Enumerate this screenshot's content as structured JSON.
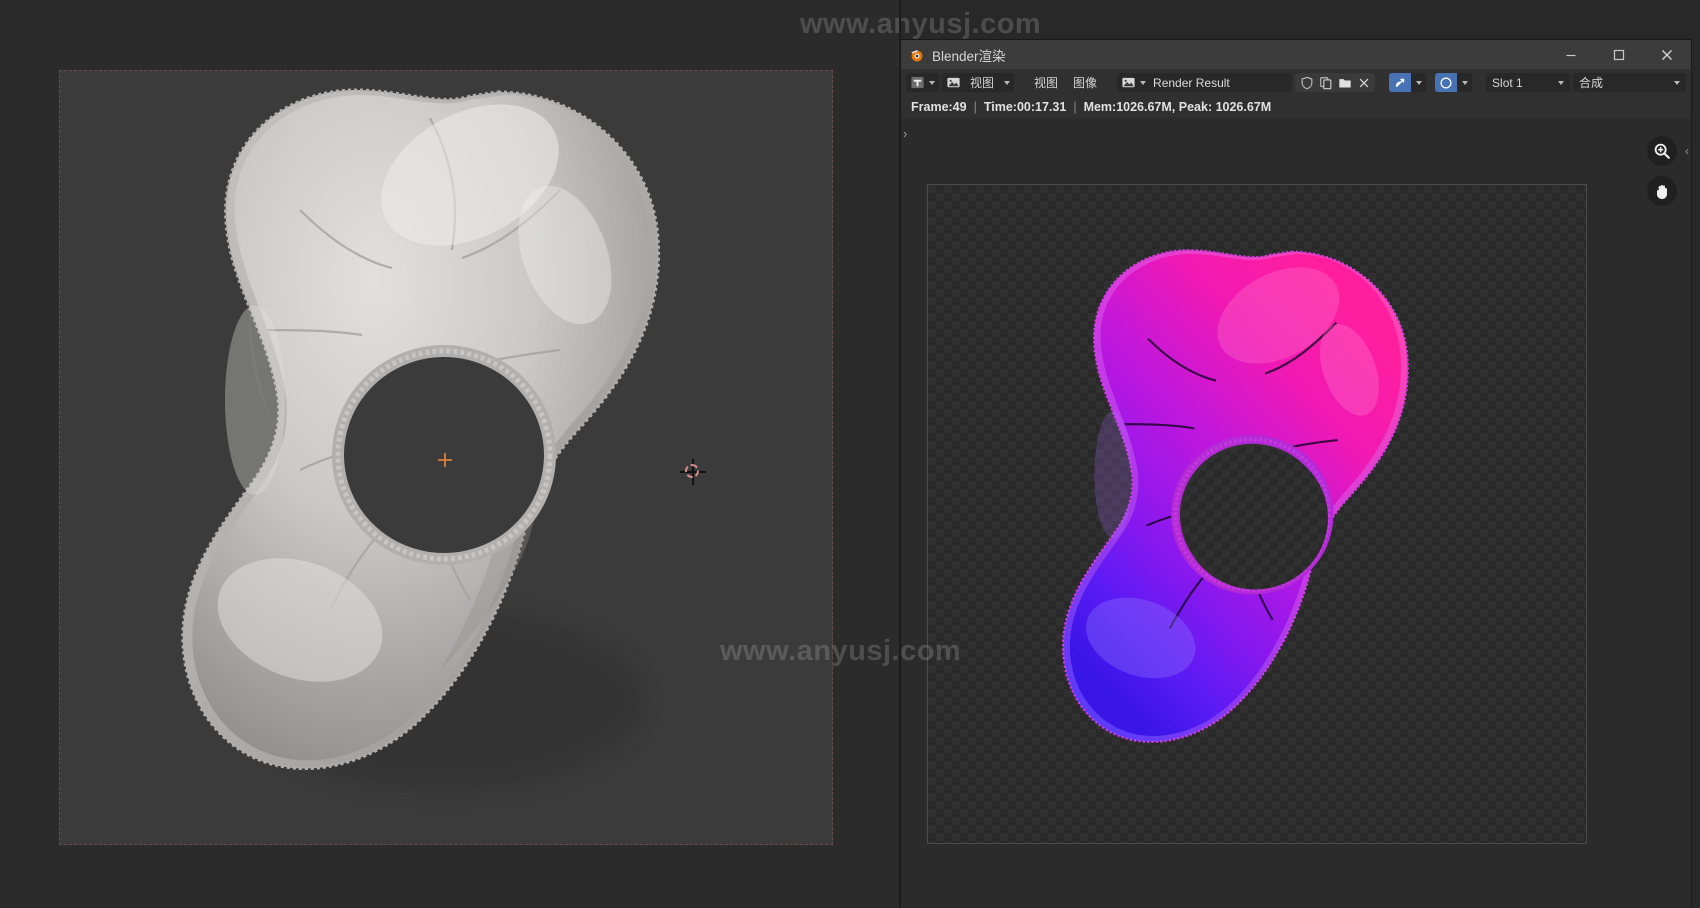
{
  "window": {
    "title": "Blender渲染",
    "app_icon": "blender-icon",
    "controls": {
      "minimize_label": "—",
      "maximize_label": "□",
      "close_label": "✕"
    }
  },
  "toolbar": {
    "editor_type_icon": "image-editor-icon",
    "mode_icon": "image-icon",
    "mode_label": "视图",
    "menus": [
      {
        "label": "视图",
        "name": "menu-view"
      },
      {
        "label": "图像",
        "name": "menu-image"
      }
    ],
    "datablock": {
      "browse_icon": "image-browse-icon",
      "name": "Render Result",
      "actions": [
        {
          "icon": "shield-icon",
          "name": "fake-user-button"
        },
        {
          "icon": "copy-icon",
          "name": "new-image-button"
        },
        {
          "icon": "folder-icon",
          "name": "open-image-button"
        },
        {
          "icon": "close-icon",
          "name": "unlink-image-button"
        }
      ]
    },
    "display_channels_icon": "render-pass-icon",
    "view_transform_icon": "color-management-icon",
    "slot": {
      "label": "Slot 1",
      "name": "render-slot-select"
    },
    "layer": {
      "label": "合成",
      "name": "view-layer-select"
    }
  },
  "status": {
    "frame": "Frame:49",
    "time": "Time:00:17.31",
    "memory": "Mem:1026.67M, Peak: 1026.67M",
    "separator": "|"
  },
  "image_editor": {
    "sidebar_toggle": "›",
    "collapse_toggle": "‹",
    "tools": [
      {
        "icon": "zoom-in-icon",
        "name": "zoom-tool-button"
      },
      {
        "icon": "hand-pan-icon",
        "name": "pan-tool-button"
      }
    ],
    "result_alt": "render-result-image"
  },
  "viewport": {
    "watermark": "www.anyusj.com",
    "cursor_icon": "3d-cursor-icon",
    "origin_icon": "object-origin-icon",
    "model_alt": "inflated-balloon-shape-solid-shading"
  },
  "colors": {
    "accent_blue": "#4772b3",
    "window_bg": "#303030",
    "titlebar_bg": "#3c3c3c",
    "viewport_bg": "#3b3b3b",
    "render_magenta": "#e81fa0",
    "render_violet": "#a01ae8",
    "render_blue": "#3a15e8",
    "cursor_red": "#d28a8a",
    "origin_orange": "#e8883a"
  }
}
